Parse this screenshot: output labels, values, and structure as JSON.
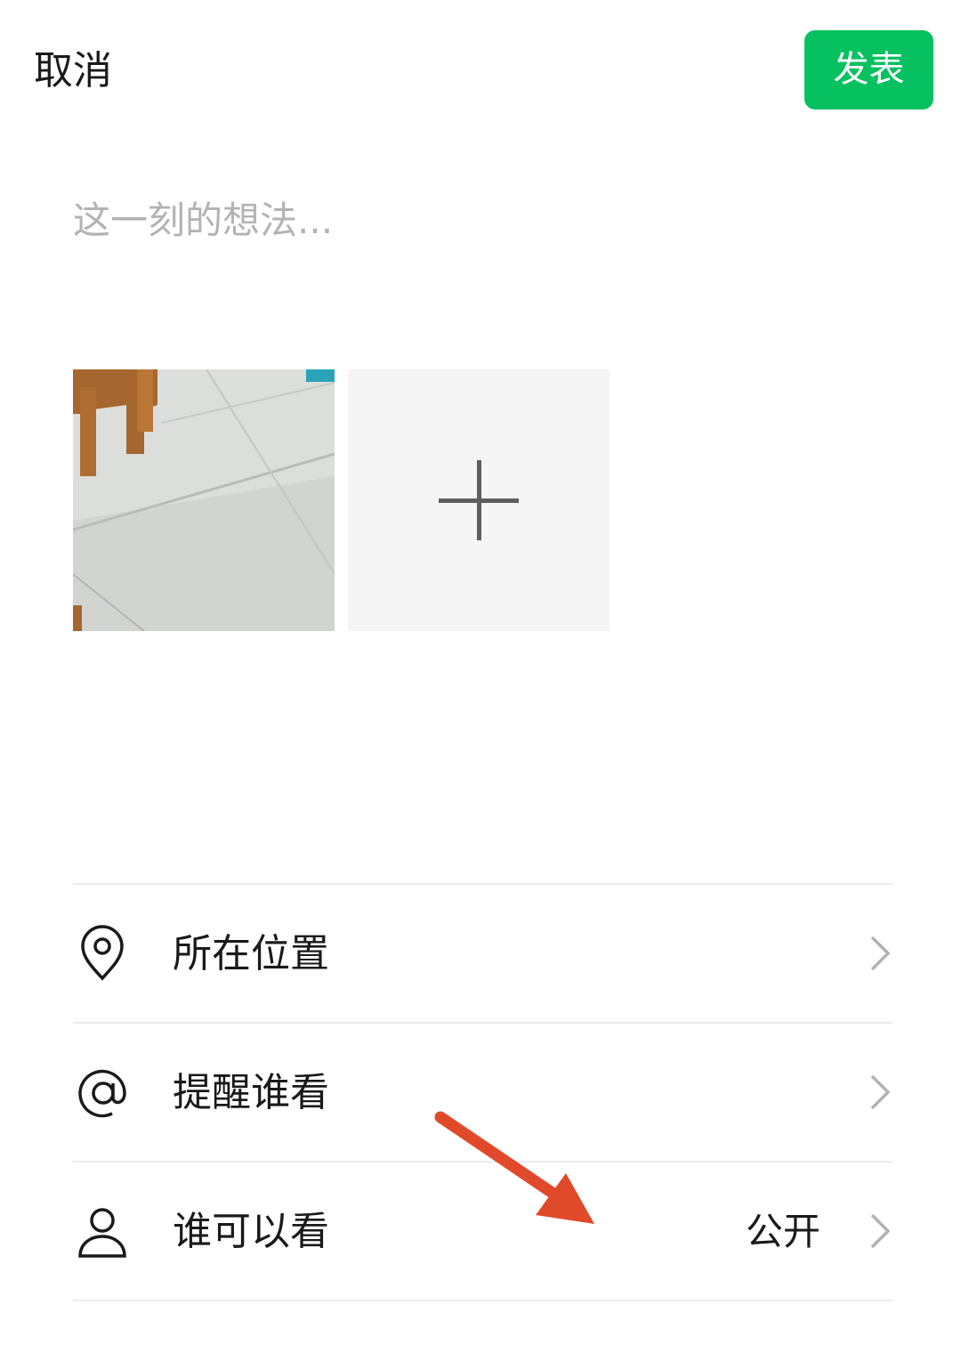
{
  "header": {
    "cancel_label": "取消",
    "publish_label": "发表",
    "publish_color": "#07c160"
  },
  "composer": {
    "placeholder": "这一刻的想法..."
  },
  "media": {
    "add_icon": "plus-icon"
  },
  "options": [
    {
      "label": "所在位置",
      "icon": "location-pin-icon",
      "value": ""
    },
    {
      "label": "提醒谁看",
      "icon": "at-sign-icon",
      "value": ""
    },
    {
      "label": "谁可以看",
      "icon": "person-icon",
      "value": "公开"
    }
  ],
  "annotation": {
    "arrow_color": "#e04a2b"
  }
}
